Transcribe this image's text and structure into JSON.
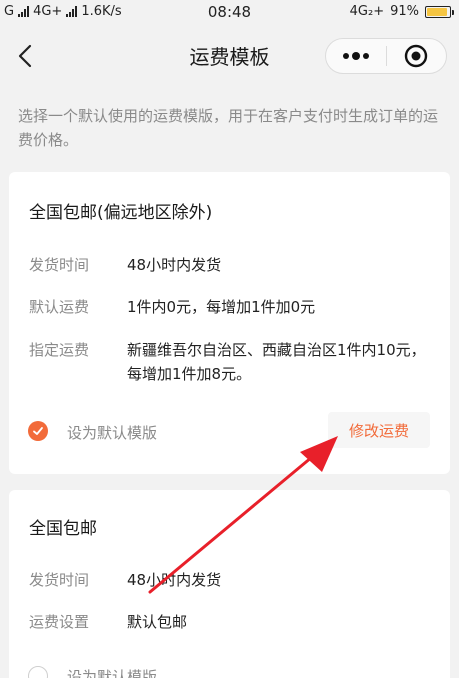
{
  "status_bar": {
    "carrier_left": "G",
    "network_left": "4G+",
    "speed": "1.6K/s",
    "time": "08:48",
    "network_right": "4G₂+",
    "battery": "91%",
    "battery_level": 0.91
  },
  "nav": {
    "title": "运费模板",
    "back_icon": "back-chevron-icon",
    "more_icon": "more-dots-icon",
    "close_icon": "target-circle-icon"
  },
  "intro": "选择一个默认使用的运费模版，用于在客户支付时生成订单的运费价格。",
  "templates": [
    {
      "title": "全国包邮(偏远地区除外)",
      "rows": [
        {
          "label": "发货时间",
          "value": "48小时内发货"
        },
        {
          "label": "默认运费",
          "value": "1件内0元，每增加1件加0元"
        },
        {
          "label": "指定运费",
          "value": "新疆维吾尔自治区、西藏自治区1件内10元，每增加1件加8元。"
        }
      ],
      "default_label": "设为默认模版",
      "is_default": true,
      "edit_label": "修改运费"
    },
    {
      "title": "全国包邮",
      "rows": [
        {
          "label": "发货时间",
          "value": "48小时内发货"
        },
        {
          "label": "运费设置",
          "value": "默认包邮"
        }
      ],
      "default_label": "设为默认模版",
      "is_default": false
    }
  ],
  "colors": {
    "accent": "#f26b3a",
    "annotation_arrow": "#e8202a",
    "background": "#f2f2f2"
  }
}
